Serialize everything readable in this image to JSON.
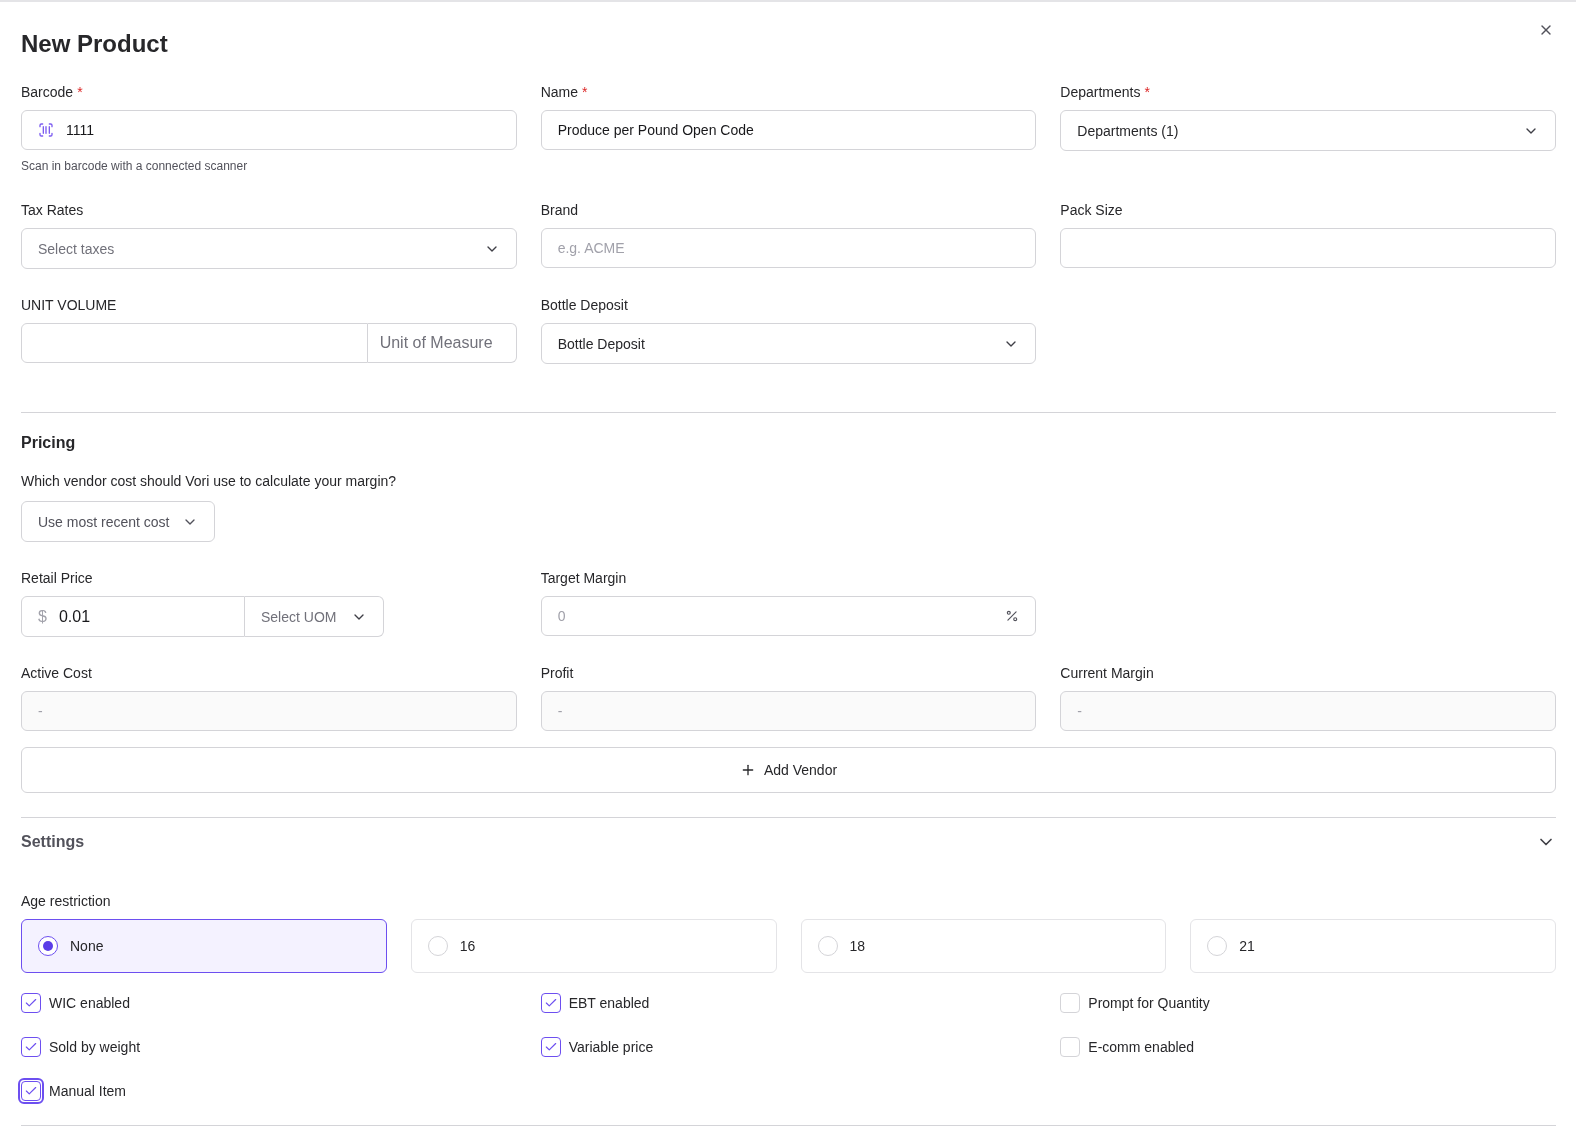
{
  "dialog": {
    "title": "New Product"
  },
  "general_fields": [
    {
      "kind": "barcode",
      "label": "Barcode",
      "required_mark": "*",
      "value": "1111",
      "hint": "Scan in barcode with a connected scanner"
    },
    {
      "kind": "text",
      "label": "Name",
      "required_mark": "*",
      "value": "Produce per Pound Open Code"
    },
    {
      "kind": "select",
      "label": "Departments",
      "required_mark": "*",
      "value": "Departments (1)"
    },
    {
      "kind": "select",
      "label": "Tax Rates",
      "placeholder": "Select taxes"
    },
    {
      "kind": "text",
      "label": "Brand",
      "placeholder": "e.g. ACME"
    },
    {
      "kind": "text",
      "label": "Pack Size"
    },
    {
      "kind": "unit",
      "label": "UNIT VOLUME",
      "unit_placeholder": "Unit of Measure"
    },
    {
      "kind": "select",
      "label": "Bottle Deposit",
      "value": "Bottle Deposit"
    }
  ],
  "pricing": {
    "title": "Pricing",
    "question": "Which vendor cost should Vori use to calculate your margin?",
    "cost_select": "Use most recent cost",
    "retail": {
      "label": "Retail Price",
      "currency": "$",
      "value": "0.01",
      "uom_placeholder": "Select UOM"
    },
    "target_margin": {
      "label": "Target Margin",
      "placeholder": "0"
    },
    "readonly_fields": [
      {
        "label": "Active Cost",
        "placeholder": "-"
      },
      {
        "label": "Profit",
        "placeholder": "-"
      },
      {
        "label": "Current Margin",
        "placeholder": "-"
      }
    ],
    "add_vendor": "Add Vendor"
  },
  "settings": {
    "title": "Settings",
    "age_label": "Age restriction",
    "age_options": [
      {
        "label": "None",
        "selected": true
      },
      {
        "label": "16",
        "selected": false
      },
      {
        "label": "18",
        "selected": false
      },
      {
        "label": "21",
        "selected": false
      }
    ],
    "checkboxes": [
      {
        "label": "WIC enabled",
        "checked": true
      },
      {
        "label": "EBT enabled",
        "checked": true
      },
      {
        "label": "Prompt for Quantity",
        "checked": false
      },
      {
        "label": "Sold by weight",
        "checked": true
      },
      {
        "label": "Variable price",
        "checked": true
      },
      {
        "label": "E-comm enabled",
        "checked": false
      },
      {
        "label": "Manual Item",
        "checked": true,
        "focused": true
      }
    ]
  }
}
